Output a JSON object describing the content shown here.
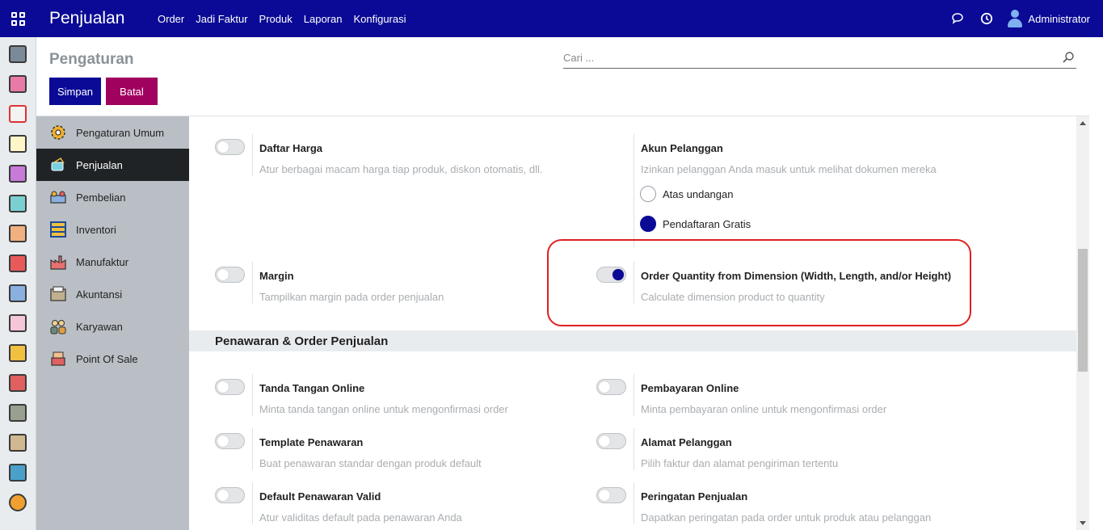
{
  "topbar": {
    "app_title": "Penjualan",
    "menu": [
      "Order",
      "Jadi Faktur",
      "Produk",
      "Laporan",
      "Konfigurasi"
    ],
    "user": "Administrator",
    "bg_color": "#0a0a96"
  },
  "control_panel": {
    "title": "Pengaturan",
    "search_placeholder": "Cari ...",
    "save_label": "Simpan",
    "cancel_label": "Batal"
  },
  "sidebar": {
    "items": [
      {
        "label": "Pengaturan Umum",
        "icon": "gear-icon"
      },
      {
        "label": "Penjualan",
        "icon": "sales-icon",
        "active": true
      },
      {
        "label": "Pembelian",
        "icon": "purchase-icon"
      },
      {
        "label": "Inventori",
        "icon": "inventory-icon"
      },
      {
        "label": "Manufaktur",
        "icon": "factory-icon"
      },
      {
        "label": "Akuntansi",
        "icon": "accounting-icon"
      },
      {
        "label": "Karyawan",
        "icon": "employees-icon"
      },
      {
        "label": "Point Of Sale",
        "icon": "pos-icon"
      }
    ]
  },
  "settings": {
    "daftar_harga": {
      "title": "Daftar Harga",
      "desc": "Atur berbagai macam harga tiap produk, diskon otomatis, dll.",
      "enabled": false
    },
    "akun_pelanggan": {
      "title": "Akun Pelanggan",
      "desc": "Izinkan pelanggan Anda masuk untuk melihat dokumen mereka",
      "options": [
        {
          "label": "Atas undangan",
          "checked": false
        },
        {
          "label": "Pendaftaran Gratis",
          "checked": true
        }
      ]
    },
    "margin": {
      "title": "Margin",
      "desc": "Tampilkan margin pada order penjualan",
      "enabled": false
    },
    "order_qty_dimension": {
      "title": "Order Quantity from Dimension (Width, Length, and/or Height)",
      "desc": "Calculate dimension product to quantity",
      "enabled": true
    }
  },
  "section": {
    "title": "Penawaran & Order Penjualan",
    "items": [
      {
        "title": "Tanda Tangan Online",
        "desc": "Minta tanda tangan online untuk mengonfirmasi order",
        "enabled": false
      },
      {
        "title": "Pembayaran Online",
        "desc": "Minta pembayaran online untuk mengonfirmasi order",
        "enabled": false
      },
      {
        "title": "Template Penawaran",
        "desc": "Buat penawaran standar dengan produk default",
        "enabled": false
      },
      {
        "title": "Alamat Pelanggan",
        "desc": "Pilih faktur dan alamat pengiriman tertentu",
        "enabled": false
      },
      {
        "title": "Default Penawaran Valid",
        "desc": "Atur validitas default pada penawaran Anda",
        "enabled": false
      },
      {
        "title": "Peringatan Penjualan",
        "desc": "Dapatkan peringatan pada order untuk produk atau pelanggan",
        "enabled": false
      }
    ]
  },
  "colors": {
    "primary": "#0a0a96",
    "cancel": "#a0005e",
    "highlight": "#e02020"
  }
}
